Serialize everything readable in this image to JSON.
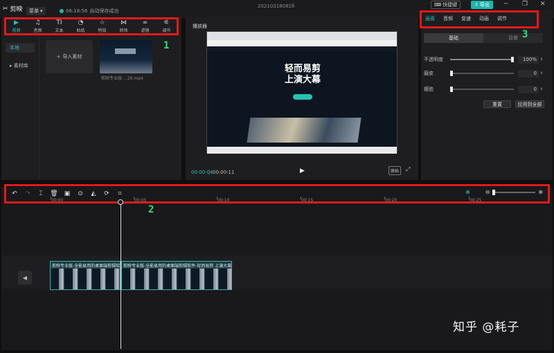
{
  "titlebar": {
    "app_name": "剪映",
    "menu_label": "菜单",
    "save_time": "06:18:56",
    "save_text": "自动保存成功",
    "project_name": "20210318081б",
    "shortcut_label": "快捷键",
    "export_label": "导出"
  },
  "toolbar": {
    "items": [
      {
        "label": "视频",
        "icon": "video-icon"
      },
      {
        "label": "音频",
        "icon": "audio-icon"
      },
      {
        "label": "文本",
        "icon": "text-icon"
      },
      {
        "label": "贴纸",
        "icon": "sticker-icon"
      },
      {
        "label": "特效",
        "icon": "effects-icon"
      },
      {
        "label": "转场",
        "icon": "transition-icon"
      },
      {
        "label": "滤镜",
        "icon": "filter-icon"
      },
      {
        "label": "调节",
        "icon": "adjust-icon"
      }
    ]
  },
  "media": {
    "side_local": "本地",
    "side_library": "素材库",
    "import_label": "导入素材",
    "clip_name": "剪映专业版-...29.mp4"
  },
  "annotations": {
    "n1": "1",
    "n2": "2",
    "n3": "3"
  },
  "player": {
    "title": "播放器",
    "hero_line1": "轻而易剪",
    "hero_line2": "上演大幕",
    "time_current": "00:00:04",
    "time_sep": "|",
    "time_total": "00:00:11",
    "original_label": "原始"
  },
  "props": {
    "tabs": [
      "画面",
      "音频",
      "变速",
      "动画",
      "调节"
    ],
    "subtabs": [
      "基础",
      "背景"
    ],
    "opacity_label": "不透明度",
    "opacity_value": "100%",
    "opacity": 1.0,
    "smooth_label": "磨皮",
    "smooth_value": "0",
    "slim_label": "瘦脸",
    "slim_value": "0",
    "reset_label": "重置",
    "apply_all_label": "应用到全部"
  },
  "timeline": {
    "ticks": [
      "00:00",
      "00:05",
      "00:10",
      "00:15",
      "00:20",
      "00:25"
    ],
    "clip_title": "剪映专业版-全能易用的桌面端剪辑软件-轻而易剪 上演大幕"
  },
  "watermark": "知乎 @耗子"
}
